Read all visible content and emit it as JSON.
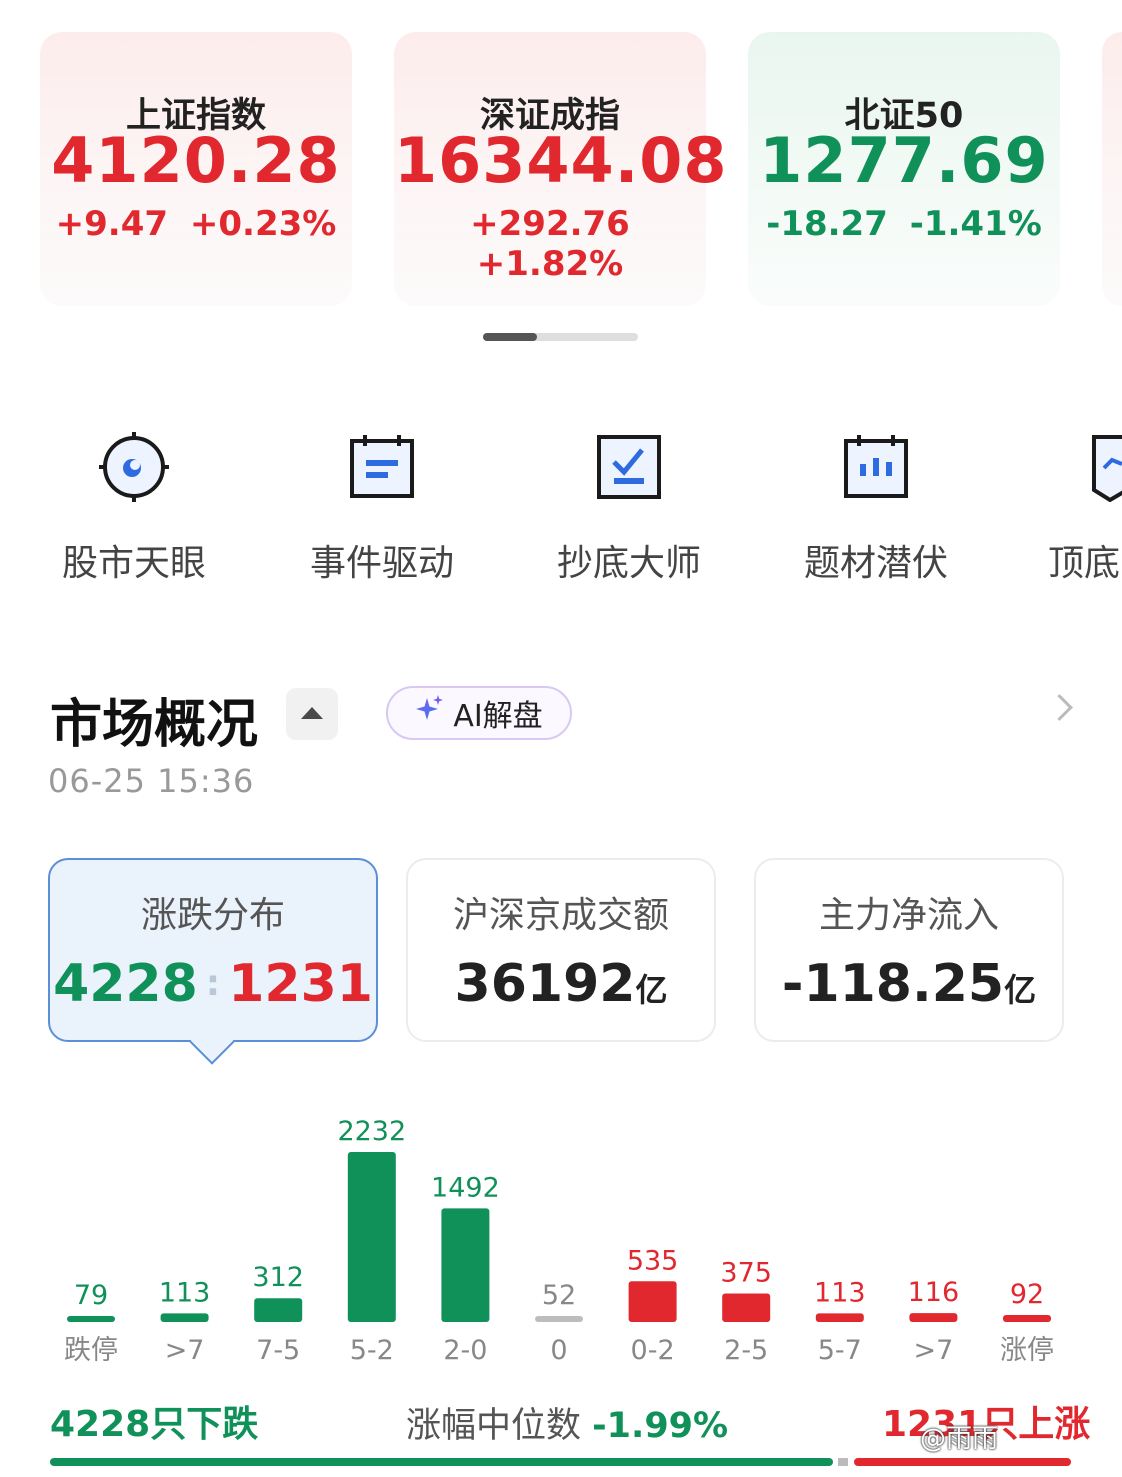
{
  "indices": [
    {
      "name": "上证指数",
      "value": "4120.28",
      "change": "+9.47",
      "pct": "+0.23%",
      "trend": "up"
    },
    {
      "name": "深证成指",
      "value": "16344.08",
      "change": "+292.76",
      "pct": "+1.82%",
      "trend": "up"
    },
    {
      "name": "北证50",
      "value": "1277.69",
      "change": "-18.27",
      "pct": "-1.41%",
      "trend": "down"
    }
  ],
  "tools": [
    {
      "label": "股市天眼",
      "icon": "target-eye-icon"
    },
    {
      "label": "事件驱动",
      "icon": "calendar-event-icon"
    },
    {
      "label": "抄底大师",
      "icon": "chart-check-icon"
    },
    {
      "label": "题材潜伏",
      "icon": "calendar-candles-icon"
    },
    {
      "label": "顶底",
      "icon": "top-bottom-icon"
    }
  ],
  "overview": {
    "title": "市场概况",
    "ai_label": "AI解盘",
    "time": "06-25 15:36",
    "cards": {
      "updown": {
        "title": "涨跌分布",
        "down": "4228",
        "up": "1231"
      },
      "turnover": {
        "title": "沪深京成交额",
        "value": "36192",
        "unit": "亿"
      },
      "netflow": {
        "title": "主力净流入",
        "value": "-118.25",
        "unit": "亿"
      }
    }
  },
  "chart_data": {
    "type": "bar",
    "categories": [
      "跌停",
      ">7",
      "7-5",
      "5-2",
      "2-0",
      "0",
      "0-2",
      "2-5",
      "5-7",
      ">7",
      "涨停"
    ],
    "values": [
      79,
      113,
      312,
      2232,
      1492,
      52,
      535,
      375,
      113,
      116,
      92
    ],
    "colors": [
      "#11915a",
      "#11915a",
      "#11915a",
      "#11915a",
      "#11915a",
      "#bdbdbd",
      "#e0282e",
      "#e0282e",
      "#e0282e",
      "#e0282e",
      "#e0282e"
    ]
  },
  "footer": {
    "down_text": "4228只下跌",
    "median_label": "涨幅中位数",
    "median_value": "-1.99%",
    "up_text": "1231只上涨",
    "down_share": 0.7745
  },
  "watermark": "@雨雨"
}
